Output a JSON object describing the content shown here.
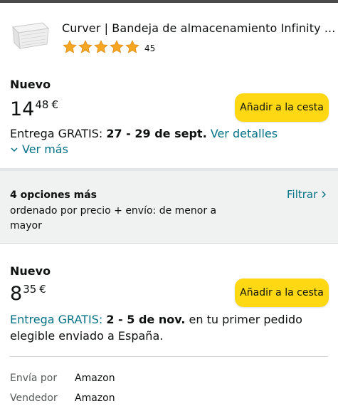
{
  "product": {
    "title": "Curver | Bandeja de almacenamiento Infinity ...",
    "rating_count": "45",
    "rating_stars": 5
  },
  "offers": [
    {
      "condition": "Nuevo",
      "price_whole": "14",
      "price_fraction": "48",
      "currency": "€",
      "add_to_cart_label": "Añadir a la cesta",
      "delivery_prefix": "Entrega GRATIS: ",
      "delivery_dates": "27 - 29 de sept.",
      "details_link": "Ver detalles",
      "see_more_label": "Ver más"
    },
    {
      "condition": "Nuevo",
      "price_whole": "8",
      "price_fraction": "35",
      "currency": "€",
      "add_to_cart_label": "Añadir a la cesta",
      "delivery_prefix": "Entrega GRATIS:",
      "delivery_dates": "2 - 5 de nov.",
      "delivery_suffix": "en tu primer pedido elegible enviado a España.",
      "ships_from_label": "Envía por",
      "ships_from_value": "Amazon",
      "sold_by_label": "Vendedor",
      "sold_by_value": "Amazon"
    }
  ],
  "options_bar": {
    "count_label": "4 opciones más",
    "sort_text": "ordenado por precio + envío: de menor a mayor",
    "filter_label": "Filtrar"
  },
  "colors": {
    "accent_link": "#007185",
    "button_yellow": "#ffd814",
    "star_orange": "#f5a623"
  },
  "icons": {
    "star": "star-icon",
    "see_more": "chevron-down-icon",
    "filter": "chevron-right-icon"
  }
}
